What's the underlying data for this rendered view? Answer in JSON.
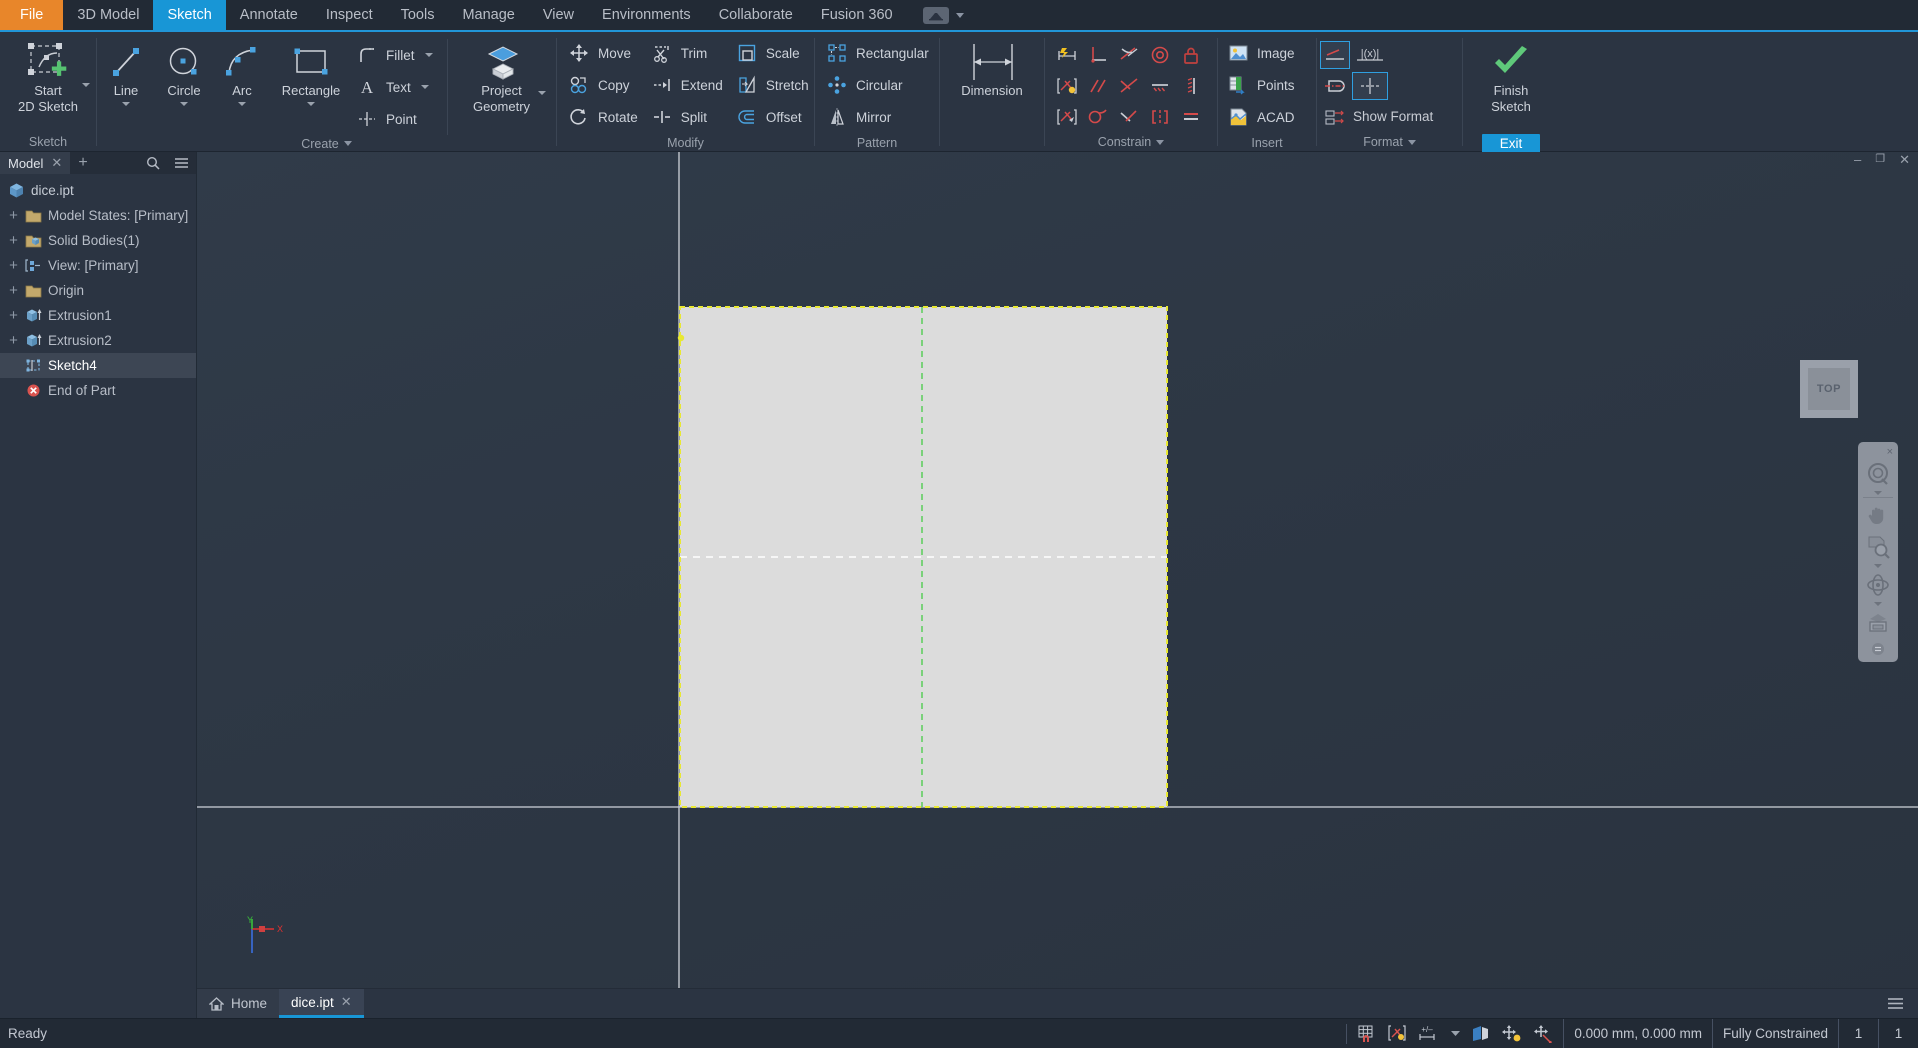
{
  "menubar": {
    "items": [
      {
        "label": "File",
        "style": "file"
      },
      {
        "label": "3D Model",
        "style": "normal"
      },
      {
        "label": "Sketch",
        "style": "active"
      },
      {
        "label": "Annotate",
        "style": "normal"
      },
      {
        "label": "Inspect",
        "style": "normal"
      },
      {
        "label": "Tools",
        "style": "normal"
      },
      {
        "label": "Manage",
        "style": "normal"
      },
      {
        "label": "View",
        "style": "normal"
      },
      {
        "label": "Environments",
        "style": "normal"
      },
      {
        "label": "Collaborate",
        "style": "normal"
      },
      {
        "label": "Fusion 360",
        "style": "normal"
      }
    ],
    "cloud_icon": "cloud-upload-icon"
  },
  "ribbon": {
    "panels": [
      {
        "title": "Sketch",
        "big": [
          {
            "label_line1": "Start",
            "label_line2": "2D Sketch",
            "icon": "start-2d-sketch-icon",
            "has_dropdown": true
          }
        ]
      },
      {
        "title": "Create",
        "has_dropdown": true,
        "big": [
          {
            "label_line1": "Line",
            "icon": "line-icon",
            "has_dropdown": true
          },
          {
            "label_line1": "Circle",
            "icon": "circle-icon",
            "has_dropdown": true
          },
          {
            "label_line1": "Arc",
            "icon": "arc-icon",
            "has_dropdown": true
          },
          {
            "label_line1": "Rectangle",
            "icon": "rectangle-icon",
            "has_dropdown": true
          }
        ],
        "rows": [
          {
            "label": "Fillet",
            "icon": "fillet-icon",
            "has_dropdown": true
          },
          {
            "label": "Text",
            "icon": "text-icon",
            "has_dropdown": true
          },
          {
            "label": "Point",
            "icon": "point-icon",
            "has_dropdown": false
          }
        ],
        "big2": [
          {
            "label_line1": "Project",
            "label_line2": "Geometry",
            "icon": "project-geometry-icon",
            "has_dropdown": true
          }
        ]
      },
      {
        "title": "Modify",
        "rows_a": [
          {
            "label": "Move",
            "icon": "move-icon"
          },
          {
            "label": "Copy",
            "icon": "copy-icon"
          },
          {
            "label": "Rotate",
            "icon": "rotate-icon"
          }
        ],
        "rows_b": [
          {
            "label": "Trim",
            "icon": "trim-icon"
          },
          {
            "label": "Extend",
            "icon": "extend-icon"
          },
          {
            "label": "Split",
            "icon": "split-icon"
          }
        ],
        "rows_c": [
          {
            "label": "Scale",
            "icon": "scale-icon"
          },
          {
            "label": "Stretch",
            "icon": "stretch-icon"
          },
          {
            "label": "Offset",
            "icon": "offset-icon"
          }
        ]
      },
      {
        "title": "Pattern",
        "rows": [
          {
            "label": "Rectangular",
            "icon": "rectangular-pattern-icon"
          },
          {
            "label": "Circular",
            "icon": "circular-pattern-icon"
          },
          {
            "label": "Mirror",
            "icon": "mirror-icon"
          }
        ]
      },
      {
        "title": "",
        "big": [
          {
            "label_line1": "Dimension",
            "icon": "dimension-icon"
          }
        ]
      },
      {
        "title": "Constrain",
        "has_dropdown": true,
        "icons": [
          "dimension-constraint-icon",
          "perpendicular-icon",
          "tangent-icon",
          "concentric-icon",
          "fix-icon",
          "auto-dimension-icon",
          "parallel-icon",
          "coincident-icon",
          "horizontal-icon",
          "vertical-icon",
          "show-constraints-icon",
          "smooth-icon",
          "collinear-icon",
          "symmetric-icon",
          "equal-icon"
        ]
      },
      {
        "title": "Insert",
        "rows": [
          {
            "label": "Image",
            "icon": "image-icon"
          },
          {
            "label": "Points",
            "icon": "points-excel-icon"
          },
          {
            "label": "ACAD",
            "icon": "acad-icon"
          }
        ]
      },
      {
        "title": "Format",
        "has_dropdown": true,
        "cells": [
          {
            "icon": "construction-line-icon",
            "selected": true,
            "label": ""
          },
          {
            "icon": "driven-dimension-icon",
            "selected": false,
            "label": ""
          },
          {
            "icon": "centerline-icon",
            "selected": false,
            "label": ""
          },
          {
            "icon": "center-point-icon",
            "selected": true,
            "label": ""
          },
          {
            "icon": "show-format-icon",
            "selected": false,
            "label": "Show Format"
          }
        ]
      },
      {
        "title": "Exit",
        "big": [
          {
            "label_line1": "Finish",
            "label_line2": "Sketch",
            "icon": "green-check-icon"
          }
        ],
        "exit_label": "Exit"
      }
    ]
  },
  "browser": {
    "tab_label": "Model",
    "tab_close": "✕",
    "add_label": "+",
    "search_icon": "search-icon",
    "menu_icon": "hamburger-menu-icon",
    "tree": [
      {
        "label": "dice.ipt",
        "icon": "part-icon",
        "expander": "",
        "depth": 0,
        "selected": false
      },
      {
        "label": "Model States: [Primary]",
        "icon": "folder-icon",
        "expander": "+",
        "depth": 1,
        "selected": false
      },
      {
        "label": "Solid Bodies(1)",
        "icon": "solid-bodies-icon",
        "expander": "+",
        "depth": 1,
        "selected": false
      },
      {
        "label": "View: [Primary]",
        "icon": "view-icon",
        "expander": "+",
        "depth": 1,
        "selected": false
      },
      {
        "label": "Origin",
        "icon": "folder-icon",
        "expander": "+",
        "depth": 1,
        "selected": false
      },
      {
        "label": "Extrusion1",
        "icon": "extrusion-icon",
        "expander": "+",
        "depth": 1,
        "selected": false
      },
      {
        "label": "Extrusion2",
        "icon": "extrusion-icon",
        "expander": "+",
        "depth": 1,
        "selected": false
      },
      {
        "label": "Sketch4",
        "icon": "sketch-icon",
        "expander": "",
        "depth": 1,
        "selected": true
      },
      {
        "label": "End of Part",
        "icon": "end-of-part-icon",
        "expander": "",
        "depth": 1,
        "selected": false
      }
    ]
  },
  "viewport": {
    "viewcube_label": "TOP",
    "navbar_icons": [
      "zoom-icon",
      "pan-icon",
      "zoom-window-icon",
      "orbit-icon",
      "look-at-icon"
    ],
    "navbar_close": "×",
    "sketch": {
      "profile_fill": "#dcdcdc",
      "edge_color": "#e8e832",
      "centerline_color": "#6fd06f",
      "projected_color": "#ffffff",
      "axis_x_color": "#e03030",
      "axis_y_color": "#39c139",
      "axis_z_color": "#3a6fe0",
      "axis_labels": {
        "x": "X",
        "y": "Y"
      }
    }
  },
  "doctabs": {
    "home_label": "Home",
    "home_icon": "home-icon",
    "tabs": [
      {
        "label": "dice.ipt",
        "close": "✕",
        "active": true
      }
    ],
    "menu_icon": "hamburger-menu-icon"
  },
  "statusbar": {
    "ready": "Ready",
    "icons": [
      "grid-snap-icon",
      "constraint-inference-icon",
      "dimension-input-icon",
      "slice-graphics-icon",
      "show-all-constraints-icon",
      "show-all-degrees-icon"
    ],
    "coordinates": "0.000 mm, 0.000 mm",
    "constraint_status": "Fully Constrained",
    "value_1": "1",
    "value_2": "1"
  },
  "window_controls": {
    "minimize": "–",
    "restore": "❐",
    "close": "✕"
  }
}
